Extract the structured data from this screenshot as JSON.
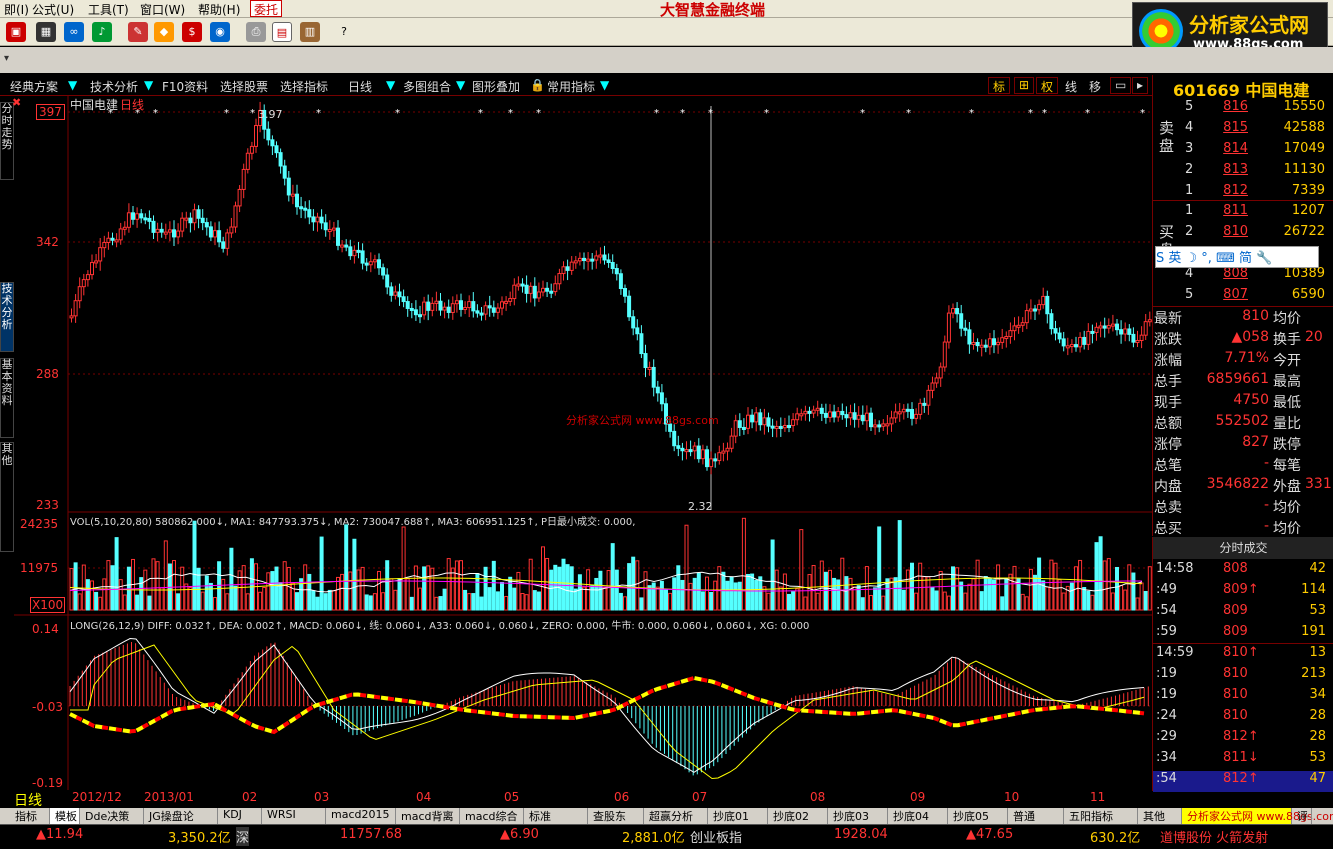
{
  "menubar": {
    "items": [
      "即(I)",
      "公式(U)",
      "工具(T)",
      "窗口(W)",
      "帮助(H)"
    ],
    "entrust": "委托",
    "app_title": "大智慧金融终端"
  },
  "logo": {
    "name": "分析家公式网",
    "url": "www.88gs.com"
  },
  "funcbar": {
    "items": [
      "经典方案",
      "技术分析",
      "F10资料",
      "选择股票",
      "选择指标",
      "日线",
      "多图组合",
      "图形叠加",
      "常用指标"
    ],
    "right_buttons": [
      "标",
      "⊞",
      "权",
      "线",
      "移"
    ]
  },
  "left_tabs": [
    "分时走势",
    "技术分析",
    "基本资料",
    "其他"
  ],
  "chart": {
    "stock_label": "中国电建",
    "period_label": "日线",
    "high_label": "3.97",
    "low_label": "2.32",
    "watermark": "分析家公式网 www.88gs.com",
    "price_axis": [
      "397",
      "342",
      "288",
      "233"
    ],
    "vol_axis": [
      "24235",
      "11975",
      "X100"
    ],
    "macd_axis": [
      "0.14",
      "-0.03",
      "-0.19"
    ],
    "vol_title": "VOL(5,10,20,80) 580862.000↓, MA1: 847793.375↓, MA2: 730047.688↑, MA3: 606951.125↑, P日最小成交: 0.000,",
    "macd_title": "LONG(26,12,9) DIFF: 0.032↑, DEA: 0.002↑, MACD: 0.060↓, 线: 0.060↓, A33: 0.060↓, 0.060↓, ZERO: 0.000, 牛市: 0.000, 0.060↓, 0.060↓, XG: 0.000",
    "months": [
      "2012/12",
      "2013/01",
      "02",
      "03",
      "04",
      "05",
      "06",
      "07",
      "08",
      "09",
      "10",
      "11"
    ]
  },
  "quote": {
    "code": "601669",
    "name": "中国电建",
    "sell": [
      {
        "lvl": "5",
        "px": "816",
        "vol": "15550"
      },
      {
        "lvl": "4",
        "px": "815",
        "vol": "42588"
      },
      {
        "lvl": "3",
        "px": "814",
        "vol": "17049"
      },
      {
        "lvl": "2",
        "px": "813",
        "vol": "11130"
      },
      {
        "lvl": "1",
        "px": "812",
        "vol": "7339"
      }
    ],
    "buy": [
      {
        "lvl": "1",
        "px": "811",
        "vol": "1207"
      },
      {
        "lvl": "2",
        "px": "810",
        "vol": "26722"
      },
      {
        "lvl": "4",
        "px": "808",
        "vol": "10389"
      },
      {
        "lvl": "5",
        "px": "807",
        "vol": "6590"
      }
    ],
    "sell_label": "卖盘",
    "buy_label": "买盘",
    "ime": "S 英 ☽ °, ⌨ 简 🔧",
    "stats": [
      {
        "k": "最新",
        "v": "810",
        "k2": "均价",
        "v2": ""
      },
      {
        "k": "涨跌",
        "v": "▲058",
        "k2": "换手",
        "v2": "20"
      },
      {
        "k": "涨幅",
        "v": "7.71%",
        "k2": "今开",
        "v2": ""
      },
      {
        "k": "总手",
        "v": "6859661",
        "k2": "最高",
        "v2": ""
      },
      {
        "k": "现手",
        "v": "4750",
        "k2": "最低",
        "v2": ""
      },
      {
        "k": "总额",
        "v": "552502",
        "k2": "量比",
        "v2": ""
      },
      {
        "k": "涨停",
        "v": "827",
        "k2": "跌停",
        "v2": ""
      },
      {
        "k": "总笔",
        "v": "-",
        "k2": "每笔",
        "v2": ""
      },
      {
        "k": "内盘",
        "v": "3546822",
        "k2": "外盘",
        "v2": "331"
      },
      {
        "k": "总卖",
        "v": "-",
        "k2": "均价",
        "v2": ""
      },
      {
        "k": "总买",
        "v": "-",
        "k2": "均价",
        "v2": ""
      }
    ]
  },
  "ticks": {
    "header": "分时成交",
    "rows": [
      {
        "t": "14:58",
        "p": "808",
        "v": "42"
      },
      {
        "t": ":49",
        "p": "809↑",
        "v": "114"
      },
      {
        "t": ":54",
        "p": "809",
        "v": "53"
      },
      {
        "t": ":59",
        "p": "809",
        "v": "191"
      },
      {
        "t": "14:59",
        "p": "810↑",
        "v": "13"
      },
      {
        "t": ":19",
        "p": "810",
        "v": "213"
      },
      {
        "t": ":19",
        "p": "810",
        "v": "34"
      },
      {
        "t": ":24",
        "p": "810",
        "v": "28"
      },
      {
        "t": ":29",
        "p": "812↑",
        "v": "28"
      },
      {
        "t": ":34",
        "p": "811↓",
        "v": "53"
      },
      {
        "t": ":54",
        "p": "812↑",
        "v": "47"
      }
    ]
  },
  "period_tab": "日线",
  "bottom_tabs": [
    "指标",
    "模板",
    "Dde决策",
    "JG操盘论",
    "KDJ",
    "WRSI",
    "macd2015",
    "macd背离",
    "macd综合",
    "标准",
    "查股东",
    "超赢分析",
    "抄底01",
    "抄底02",
    "抄底03",
    "抄底04",
    "抄底05",
    "普通",
    "五阳指标",
    "其他",
    "分析家公式网 www.88gs.com",
    "评"
  ],
  "statusbar": {
    "i1": "▲11.94",
    "i2": "3,350.2亿",
    "i3": "深",
    "i4": "11757.68",
    "i5": "▲6.90",
    "i6": "2,881.0亿",
    "i7": "创业板指",
    "i8": "1928.04",
    "i9": "▲47.65",
    "i10": "630.2亿",
    "i11": "道博股份 火箭发射"
  },
  "colors": {
    "up": "#ff3333",
    "down": "#55ffff",
    "ma_yellow": "#ffff00",
    "grid": "#770000"
  }
}
